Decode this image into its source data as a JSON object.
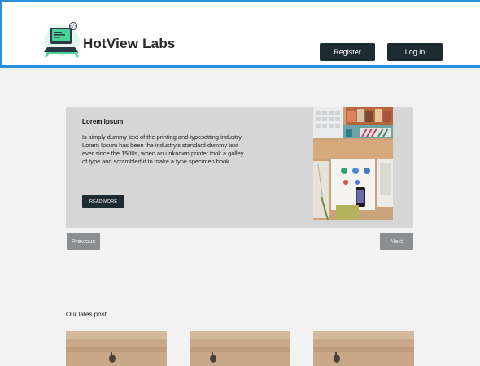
{
  "header": {
    "brand": "HotView Labs",
    "logo_icon": "laptop-code-logo-icon",
    "register_label": "Register",
    "login_label": "Log in",
    "accent_color": "#2b8fd9",
    "button_color": "#1d2b33"
  },
  "slider": {
    "title": "Lorem Ipsum",
    "text": "Is simply dummy text of the printing and typesetting industry. Lorem Ipsum has been the industry's standard dummy text ever since the 1500s, when an unknown printer took a galley of type and scrambled it to make a type specimen book.",
    "read_more_label": "READ MORE",
    "previous_label": "Previous",
    "next_label": "Next",
    "image_icon": "desk-workspace-photo"
  },
  "latest": {
    "title": "Our  lates post",
    "posts": [
      {
        "image_icon": "post-thumbnail-photo"
      },
      {
        "image_icon": "post-thumbnail-photo"
      },
      {
        "image_icon": "post-thumbnail-photo"
      }
    ]
  }
}
